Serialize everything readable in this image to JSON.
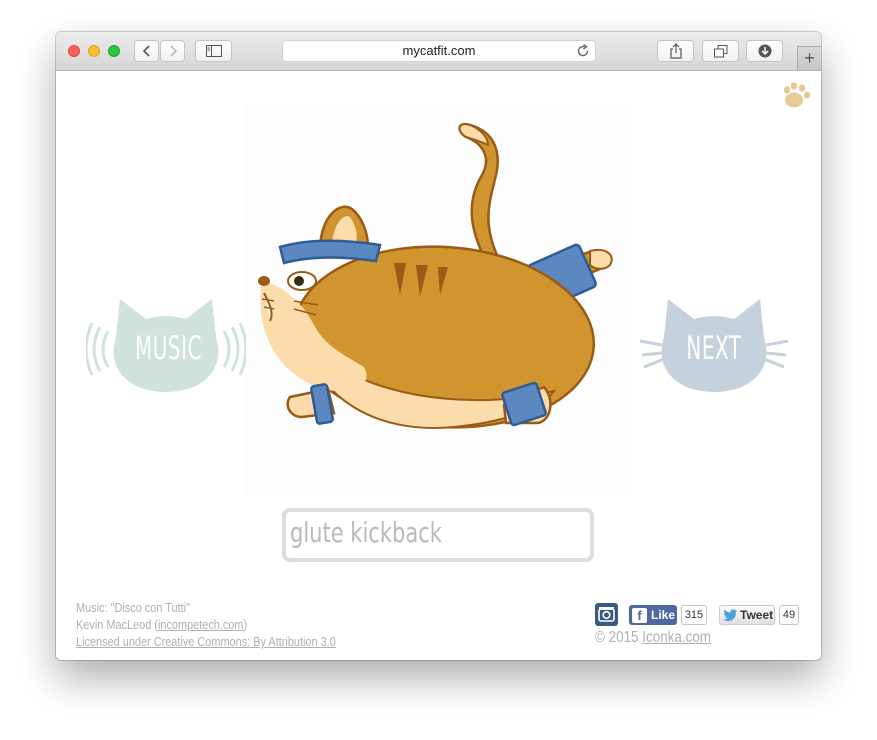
{
  "browser": {
    "url": "mycatfit.com",
    "back_icon": "chevron-left-icon",
    "forward_icon": "chevron-right-icon",
    "sidebar_icon": "sidebar-icon",
    "share_icon": "share-icon",
    "tabs_icon": "tabs-overview-icon",
    "downloads_icon": "download-icon",
    "reload_icon": "reload-icon",
    "new_tab_label": "+"
  },
  "page": {
    "logo_icon": "paw-icon",
    "music_button": "MUSIC",
    "next_button": "NEXT",
    "exercise_name": "glute kickback",
    "cat_image": "cat-doing-glute-kickback",
    "colors": {
      "music": "#cfe3dc",
      "next": "#c6d1de",
      "paw": "#e7c996",
      "cat_body": "#d0952e",
      "cat_belly": "#fcdcab",
      "cat_outline": "#9a5b16",
      "sweatband": "#5b88c1"
    }
  },
  "footer": {
    "credit_line1": "Music: \"Disco con Tutti\"",
    "credit_line2_prefix": "Kevin MacLeod (",
    "credit_link": "incompetech.com",
    "credit_line2_suffix": ")",
    "license": "Licensed under Creative Commons: By Attribution 3.0",
    "instagram_icon": "instagram-icon",
    "like_label": "Like",
    "like_count": "315",
    "tweet_label": "Tweet",
    "tweet_count": "49",
    "copyright_prefix": "© 2015 ",
    "copyright_link": "Iconka.com"
  }
}
